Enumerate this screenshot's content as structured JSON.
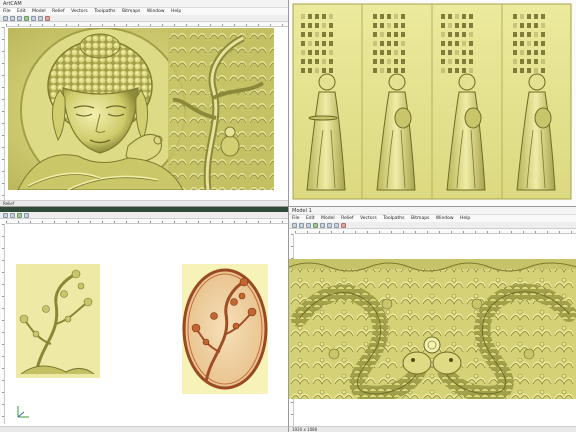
{
  "quad_tl": {
    "title": "ArtCAM",
    "menu": [
      "File",
      "Edit",
      "Model",
      "Relief",
      "Vectors",
      "Toolpaths",
      "Bitmaps",
      "Window",
      "Help"
    ],
    "status": "Relief"
  },
  "quad_tr": {
    "title": "",
    "panel_captions": [
      "",
      "",
      "",
      ""
    ]
  },
  "quad_bl": {
    "title": "",
    "menu": [],
    "status": ""
  },
  "quad_br": {
    "title": "Model 1",
    "menu": [
      "File",
      "Edit",
      "Model",
      "Relief",
      "Vectors",
      "Toolpaths",
      "Bitmaps",
      "Window",
      "Help"
    ],
    "status": "1920 x 1080"
  },
  "colors": {
    "relief_gold": "#d9d77a",
    "relief_shadow": "#8c8a3a",
    "relief_light": "#f2f0a8",
    "background_pale": "#f7f3b8",
    "tree_brown": "#b0562a"
  }
}
